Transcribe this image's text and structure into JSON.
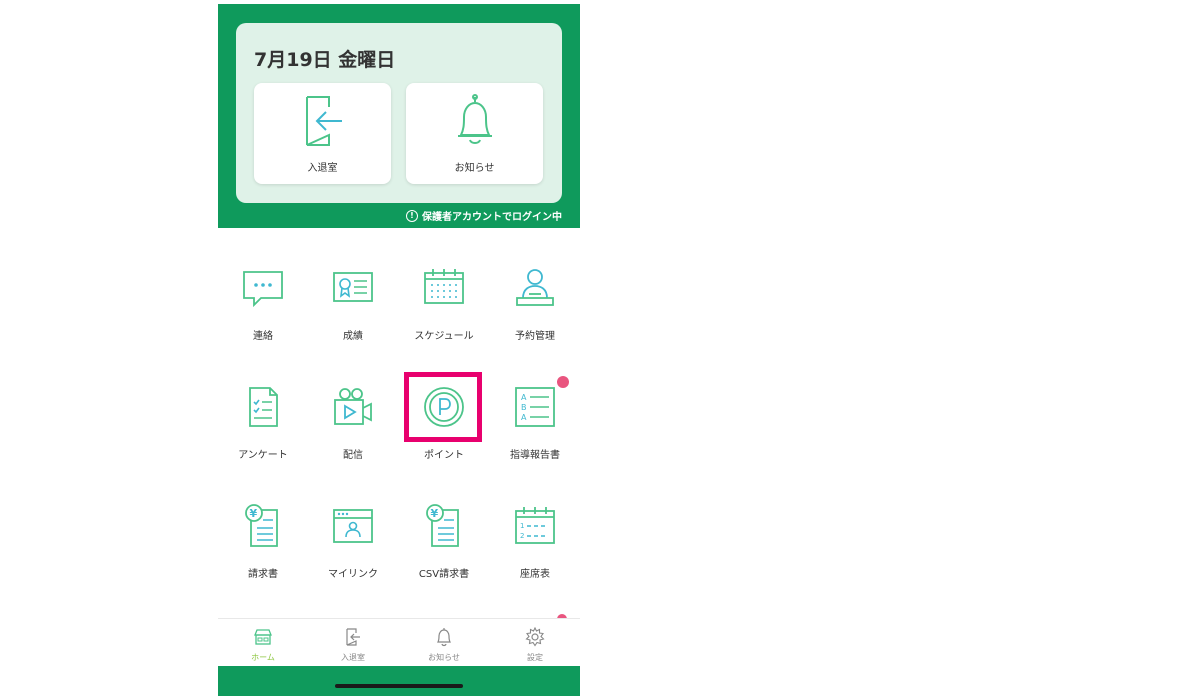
{
  "header": {
    "date": "7月19日 金曜日",
    "quick_actions": [
      {
        "label": "入退室",
        "icon": "door-enter-icon"
      },
      {
        "label": "お知らせ",
        "icon": "bell-icon"
      }
    ],
    "login_note": "保護者アカウントでログイン中"
  },
  "menu": {
    "items": [
      {
        "label": "連絡",
        "icon": "chat-bubble-icon"
      },
      {
        "label": "成績",
        "icon": "certificate-icon"
      },
      {
        "label": "スケジュール",
        "icon": "calendar-icon"
      },
      {
        "label": "予約管理",
        "icon": "person-desk-icon"
      },
      {
        "label": "アンケート",
        "icon": "checklist-icon"
      },
      {
        "label": "配信",
        "icon": "video-camera-icon"
      },
      {
        "label": "ポイント",
        "icon": "point-coin-icon"
      },
      {
        "label": "指導報告書",
        "icon": "report-list-icon"
      },
      {
        "label": "請求書",
        "icon": "invoice-yen-icon"
      },
      {
        "label": "マイリンク",
        "icon": "browser-profile-icon"
      },
      {
        "label": "CSV請求書",
        "icon": "csv-invoice-icon"
      },
      {
        "label": "座席表",
        "icon": "seat-table-icon"
      }
    ]
  },
  "tabbar": {
    "items": [
      {
        "label": "ホーム",
        "icon": "home-icon",
        "active": true
      },
      {
        "label": "入退室",
        "icon": "door-enter-icon"
      },
      {
        "label": "お知らせ",
        "icon": "bell-icon"
      },
      {
        "label": "設定",
        "icon": "gear-icon"
      }
    ]
  },
  "colors": {
    "brand_green": "#0f9a5c",
    "icon_green": "#4cc48a",
    "icon_teal": "#3fb8d0",
    "highlight": "#e8006e",
    "badge": "#e9557f",
    "active_tab": "#8cc63f"
  }
}
